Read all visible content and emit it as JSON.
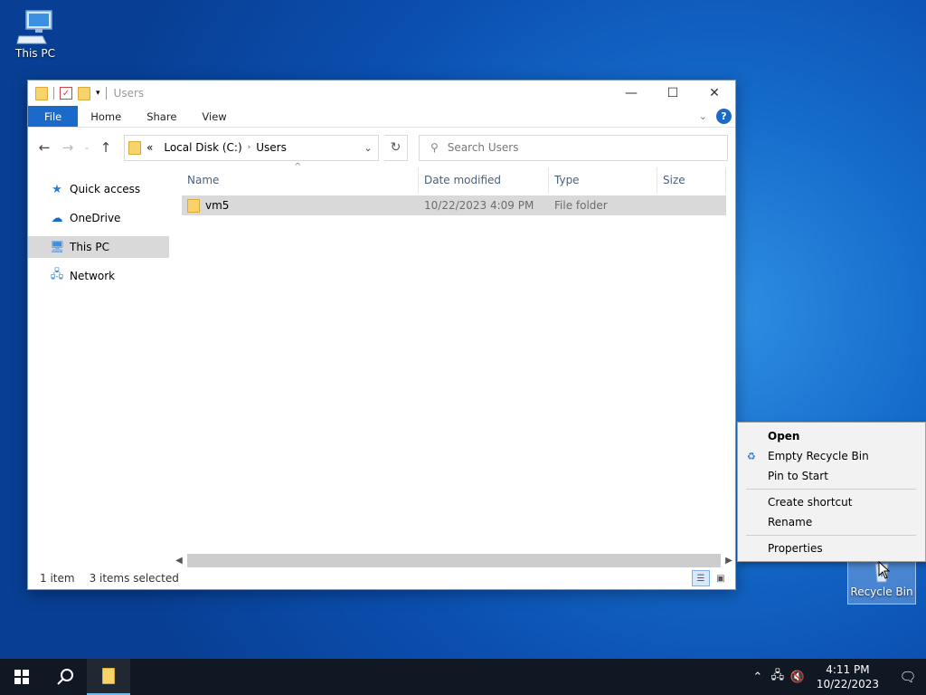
{
  "desktop": {
    "this_pc_label": "This PC",
    "recycle_bin_label": "Recycle Bin"
  },
  "window": {
    "title": "Users",
    "ribbon_tabs": [
      "File",
      "Home",
      "Share",
      "View"
    ],
    "address": {
      "overflow": "«",
      "segments": [
        "Local Disk (C:)",
        "Users"
      ]
    },
    "search_placeholder": "Search Users",
    "nav_items": [
      {
        "label": "Quick access",
        "icon": "star-icon"
      },
      {
        "label": "OneDrive",
        "icon": "cloud-icon"
      },
      {
        "label": "This PC",
        "icon": "computer-icon",
        "selected": true
      },
      {
        "label": "Network",
        "icon": "network-icon"
      }
    ],
    "columns": [
      "Name",
      "Date modified",
      "Type",
      "Size"
    ],
    "rows": [
      {
        "name": "vm5",
        "date_modified": "10/22/2023 4:09 PM",
        "type": "File folder",
        "size": ""
      }
    ],
    "status": {
      "item_count": "1 item",
      "selection": "3 items selected"
    }
  },
  "context_menu": {
    "items": [
      "Open",
      "Empty Recycle Bin",
      "Pin to Start",
      "Create shortcut",
      "Rename",
      "Properties"
    ]
  },
  "taskbar": {
    "time": "4:11 PM",
    "date": "10/22/2023"
  },
  "colors": {
    "accent": "#1b6ac9",
    "selection_gray": "#d9d9d9",
    "taskbar": "#101823"
  }
}
